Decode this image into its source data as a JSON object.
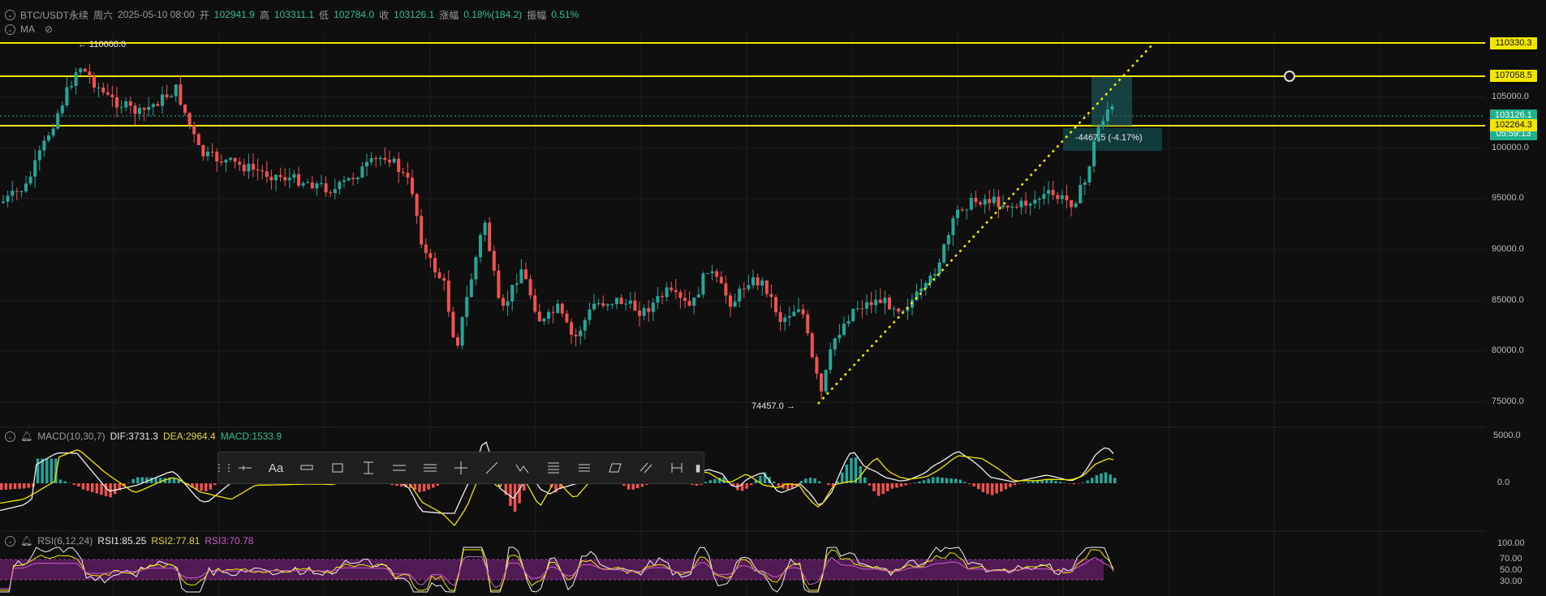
{
  "header": {
    "symbol": "BTC/USDT永续",
    "weekday": "周六",
    "datetime": "2025-05-10 08:00",
    "open_label": "开",
    "open": "102941.9",
    "high_label": "高",
    "high": "103311.1",
    "low_label": "低",
    "low": "102784.0",
    "close_label": "收",
    "close": "103126.1",
    "change_label": "涨幅",
    "change": "0.18%(184.2)",
    "amp_label": "振幅",
    "amp": "0.51%",
    "ma_label": "MA"
  },
  "macd": {
    "label": "MACD(10,30,7)",
    "dif": "DIF:3731.3",
    "dea": "DEA:2964.4",
    "macd": "MACD:1533.9"
  },
  "rsi": {
    "label": "RSI(6,12,24)",
    "rsi1": "RSI1:85.25",
    "rsi2": "RSI2:77.81",
    "rsi3": "RSI3:70.78"
  },
  "price_tags": {
    "line1": "110330.3",
    "line2": "107058.5",
    "current": "103126.1",
    "countdown": "05:59:13",
    "line3": "102264.3"
  },
  "price_axis": [
    "105000.0",
    "100000.0",
    "95000.0",
    "90000.0",
    "85000.0",
    "80000.0",
    "75000.0"
  ],
  "macd_axis": [
    "5000.0",
    "0.0"
  ],
  "rsi_axis": [
    "100.00",
    "70.00",
    "50.00",
    "30.00"
  ],
  "annotations": {
    "high_marker": "← 110000.0",
    "low_marker": "74457.0 →",
    "measure": "-4467.5 (-4.17%)"
  },
  "toolbar_icons": [
    "drag-handle-icon",
    "horizontal-ray-icon",
    "text-icon",
    "price-label-icon",
    "rectangle-icon",
    "vertical-measure-icon",
    "horizontal-line-icon",
    "parallel-channel-icon",
    "crosshair-icon",
    "trend-line-icon",
    "pattern-icon",
    "fib-retracement-icon",
    "lines-icon",
    "parallelogram-icon",
    "parallel-lines-icon",
    "date-range-icon",
    "more-handle-icon"
  ],
  "colors": {
    "up": "#26a69a",
    "down": "#ef5350",
    "level_line": "#f2e600",
    "macd_dif": "#ffffff",
    "macd_dea": "#f2e600",
    "rsi_band": "#5a1d5e"
  }
}
